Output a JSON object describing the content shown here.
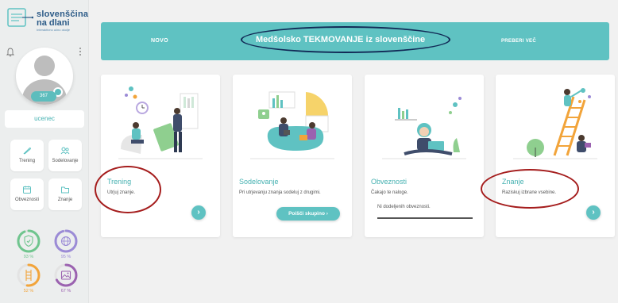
{
  "app": {
    "logo_line1": "slovenščina",
    "logo_line2": "na dlani",
    "logo_tagline": "Interaktivno učno okolje"
  },
  "sidebar": {
    "coins": "367",
    "username": "ucenec",
    "nav": [
      {
        "label": "Trening",
        "icon": "feather-icon"
      },
      {
        "label": "Sodelovanje",
        "icon": "people-icon"
      },
      {
        "label": "Obveznosti",
        "icon": "calendar-icon"
      },
      {
        "label": "Znanje",
        "icon": "folder-icon"
      }
    ],
    "progress": [
      {
        "value": 93,
        "label": "93 %",
        "color": "#6fc58e"
      },
      {
        "value": 95,
        "label": "95 %",
        "color": "#9b8bd6"
      },
      {
        "value": 52,
        "label": "52 %",
        "color": "#f2a43a"
      },
      {
        "value": 67,
        "label": "67 %",
        "color": "#9b62b0"
      }
    ]
  },
  "banner": {
    "left_label": "NOVO",
    "title": "Medšolsko TEKMOVANJE iz slovenščine",
    "right_label": "PREBERI VEČ"
  },
  "cards": [
    {
      "title": "Trening",
      "desc": "Utrjuj znanje."
    },
    {
      "title": "Sodelovanje",
      "desc": "Pri utrjevanju znanja sodeluj z drugimi.",
      "button": "Poišči skupino"
    },
    {
      "title": "Obveznosti",
      "desc": "Čakajo te naloge.",
      "extra": "Ni dodeljenih obveznosti."
    },
    {
      "title": "Znanje",
      "desc": "Raziskuj izbrane vsebine."
    }
  ],
  "colors": {
    "accent": "#5fc2c2",
    "annotation_red": "#a51d1d",
    "annotation_navy": "#122a56"
  }
}
